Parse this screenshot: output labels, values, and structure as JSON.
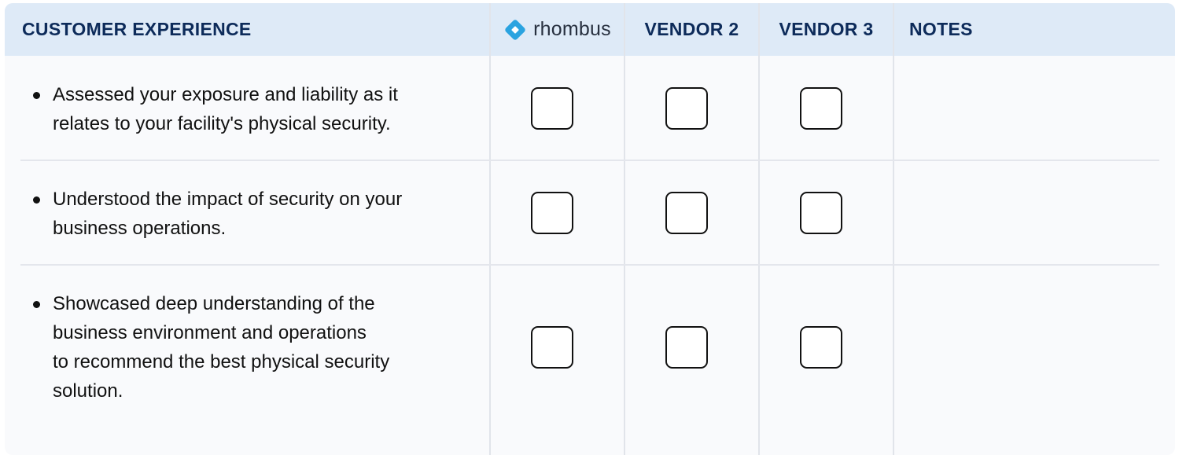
{
  "header": {
    "section_title": "CUSTOMER EXPERIENCE",
    "vendor1": {
      "name": "rhombus",
      "logo_icon": "rhombus-diamond-icon",
      "logo_color": "#2aa3e0"
    },
    "vendor2": "VENDOR 2",
    "vendor3": "VENDOR 3",
    "notes": "NOTES"
  },
  "rows": [
    {
      "lines": [
        "Assessed your exposure and liability as it",
        "relates to your facility's physical security."
      ],
      "checks": {
        "rhombus": false,
        "vendor2": false,
        "vendor3": false
      },
      "notes": ""
    },
    {
      "lines": [
        "Understood the impact of security on your",
        "business operations."
      ],
      "checks": {
        "rhombus": false,
        "vendor2": false,
        "vendor3": false
      },
      "notes": ""
    },
    {
      "lines": [
        "Showcased deep understanding of the",
        "business environment and operations",
        "to recommend the best physical security",
        "solution."
      ],
      "checks": {
        "rhombus": false,
        "vendor2": false,
        "vendor3": false
      },
      "notes": ""
    }
  ],
  "colors": {
    "header_bg": "#deeaf7",
    "header_text": "#0d2b5a",
    "body_bg": "#f9fafc",
    "grid_line": "#e1e4ea",
    "checkbox_border": "#111111"
  }
}
